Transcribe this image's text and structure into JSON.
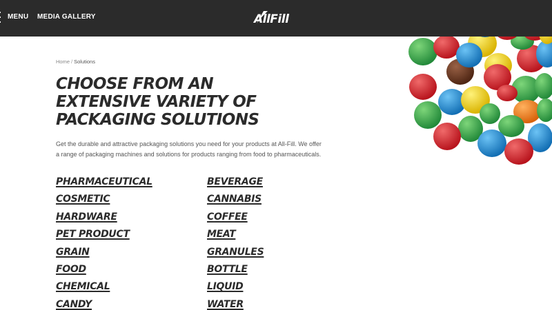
{
  "header": {
    "nav": {
      "menu_label": "MENU",
      "gallery_label": "MEDIA GALLERY"
    },
    "logo_text": "AllFill",
    "background": "#2b2b2b"
  },
  "breadcrumb": {
    "home": "Home",
    "separator": "/",
    "current": "Solutions"
  },
  "main": {
    "title": "CHOOSE FROM AN EXTENSIVE VARIETY OF PACKAGING SOLUTIONS",
    "intro": "Get the durable and attractive packaging solutions you need for your products at All-Fill. We offer a range of packaging machines and solutions for products ranging from food to pharmaceuticals.",
    "solutions_left": [
      "PHARMACEUTICAL",
      "COSMETIC",
      "HARDWARE",
      "PET PRODUCT",
      "GRAIN",
      "FOOD",
      "CHEMICAL",
      "CANDY"
    ],
    "solutions_right": [
      "BEVERAGE",
      "CANNABIS",
      "COFFEE",
      "MEAT",
      "GRANULES",
      "BOTTLE",
      "LIQUID",
      "WATER"
    ]
  },
  "colors": {
    "text_dark": "#2b2b2b",
    "candy": [
      "#2fa04a",
      "#d8262e",
      "#f2d314",
      "#1f8ed6",
      "#f0821f",
      "#6b3a25"
    ]
  }
}
